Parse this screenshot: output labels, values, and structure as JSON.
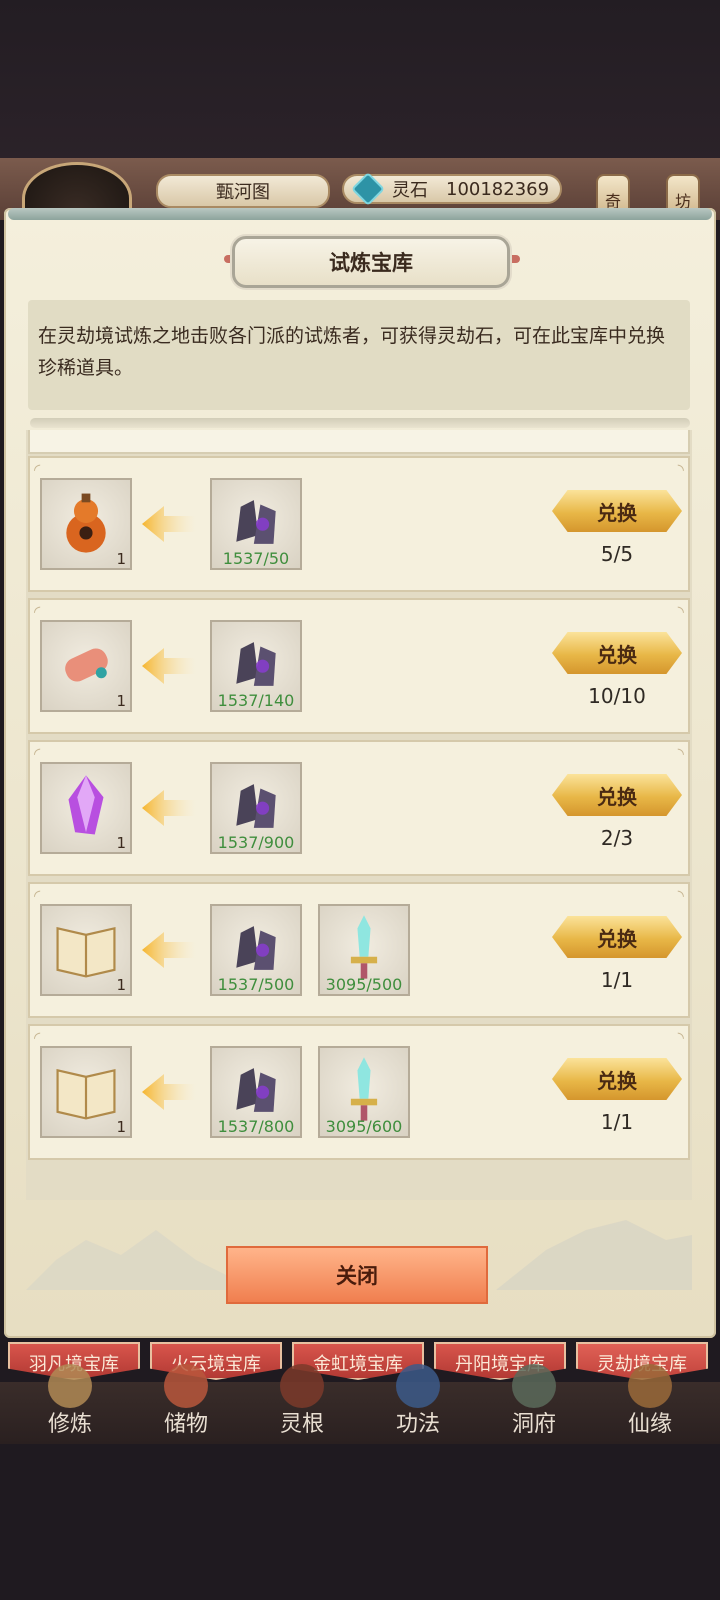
{
  "header": {
    "map_label": "甄河图",
    "resource_label": "灵石",
    "resource_value": "100182369",
    "side_tabs": [
      "奇",
      "坊"
    ]
  },
  "panel": {
    "title": "试炼宝库",
    "description": "在灵劫境试炼之地击败各门派的试炼者，可获得灵劫石，可在此宝库中兑换珍稀道具。",
    "exchange_label": "兑换",
    "close_label": "关闭"
  },
  "rows": [
    {
      "reward": "gourd-icon",
      "reward_qty": "1",
      "cost": [
        {
          "icon": "stone-icon",
          "count": "1537/50"
        }
      ],
      "limit": "5/5"
    },
    {
      "reward": "scroll-icon",
      "reward_qty": "1",
      "cost": [
        {
          "icon": "stone-icon",
          "count": "1537/140"
        }
      ],
      "limit": "10/10"
    },
    {
      "reward": "crystal-icon",
      "reward_qty": "1",
      "cost": [
        {
          "icon": "stone-icon",
          "count": "1537/900"
        }
      ],
      "limit": "2/3"
    },
    {
      "reward": "book-icon",
      "reward_qty": "1",
      "cost": [
        {
          "icon": "stone-icon",
          "count": "1537/500"
        },
        {
          "icon": "sword-icon",
          "count": "3095/500"
        }
      ],
      "limit": "1/1"
    },
    {
      "reward": "book-icon",
      "reward_qty": "1",
      "cost": [
        {
          "icon": "stone-icon",
          "count": "1537/800"
        },
        {
          "icon": "sword-icon",
          "count": "3095/600"
        }
      ],
      "limit": "1/1"
    }
  ],
  "bottom_tabs": [
    "羽凡境宝库",
    "火云境宝库",
    "金虹境宝库",
    "丹阳境宝库",
    "灵劫境宝库"
  ],
  "main_nav": [
    "修炼",
    "储物",
    "灵根",
    "功法",
    "洞府",
    "仙缘"
  ],
  "colors": {
    "accent_gold": "#e8b747",
    "close_orange": "#f07f4f",
    "count_green": "#3f8e3d",
    "tab_red": "#b33a34"
  }
}
